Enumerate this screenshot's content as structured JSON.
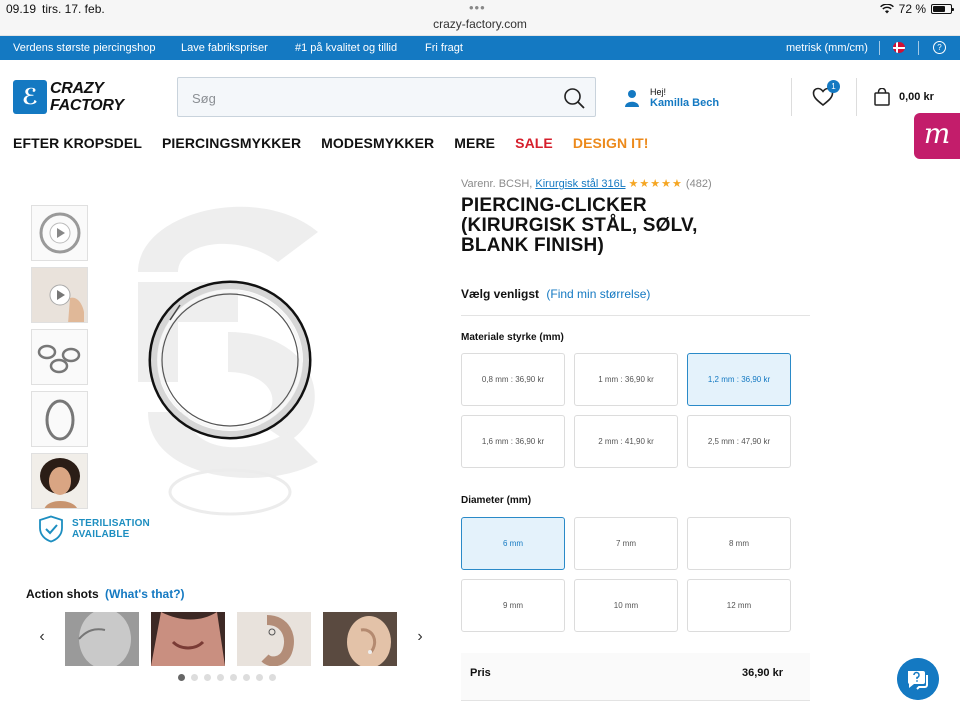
{
  "status_bar": {
    "time": "09.19",
    "date": "tirs. 17. feb.",
    "url": "crazy-factory.com",
    "battery": "72 %",
    "battery_level": 0.72
  },
  "promo_bar": {
    "items": [
      "Verdens største piercingshop",
      "Lave fabrikspriser",
      "#1 på kvalitet og tillid",
      "Fri fragt"
    ],
    "unit": "metrisk (mm/cm)"
  },
  "header": {
    "logo_line1": "CRAZY",
    "logo_line2": "FACTORY",
    "search_placeholder": "Søg",
    "user_greeting": "Hej!",
    "user_name": "Kamilla Bech",
    "wishlist_count": "1",
    "cart_total": "0,00 kr"
  },
  "nav": {
    "items": [
      {
        "label": "EFTER KROPSDEL",
        "color": "#111111"
      },
      {
        "label": "PIERCINGSMYKKER",
        "color": "#111111"
      },
      {
        "label": "MODESMYKKER",
        "color": "#111111"
      },
      {
        "label": "MERE",
        "color": "#111111"
      },
      {
        "label": "SALE",
        "color": "#d61f2c"
      },
      {
        "label": "DESIGN IT!",
        "color": "#ec8a1c"
      }
    ]
  },
  "gallery": {
    "sterilisation_line1": "STERILISATION",
    "sterilisation_line2": "AVAILABLE",
    "action_shots_title": "Action shots",
    "action_shots_link": "(What's that?)",
    "dots_total": 8,
    "dots_active": 1
  },
  "product": {
    "sku_prefix": "Varenr. BCSH,",
    "material_link": "Kirurgisk stål 316L",
    "stars": "★★★★★",
    "rating_value": 4.5,
    "review_count": "(482)",
    "title": "PIERCING-CLICKER (KIRURGISK STÅL, SØLV, BLANK FINISH)",
    "size_prompt": "Vælg venligst",
    "size_link": "(Find min størrelse)",
    "material_label": "Materiale styrke (mm)",
    "thickness_options": [
      {
        "label": "0,8 mm : 36,90 kr",
        "selected": false
      },
      {
        "label": "1 mm : 36,90 kr",
        "selected": false
      },
      {
        "label": "1,2 mm : 36,90 kr",
        "selected": true
      },
      {
        "label": "1,6 mm : 36,90 kr",
        "selected": false
      },
      {
        "label": "2 mm : 41,90 kr",
        "selected": false
      },
      {
        "label": "2,5 mm : 47,90 kr",
        "selected": false
      }
    ],
    "diameter_label": "Diameter (mm)",
    "diameter_options": [
      {
        "label": "6 mm",
        "selected": true
      },
      {
        "label": "7 mm",
        "selected": false
      },
      {
        "label": "8 mm",
        "selected": false
      },
      {
        "label": "9 mm",
        "selected": false
      },
      {
        "label": "10 mm",
        "selected": false
      },
      {
        "label": "12 mm",
        "selected": false
      }
    ],
    "price_label": "Pris",
    "price_value": "36,90 kr"
  },
  "colors": {
    "brand_blue": "#1479c2",
    "sale_red": "#d61f2c",
    "design_orange": "#ec8a1c",
    "marker_pink": "#c31d6b"
  }
}
